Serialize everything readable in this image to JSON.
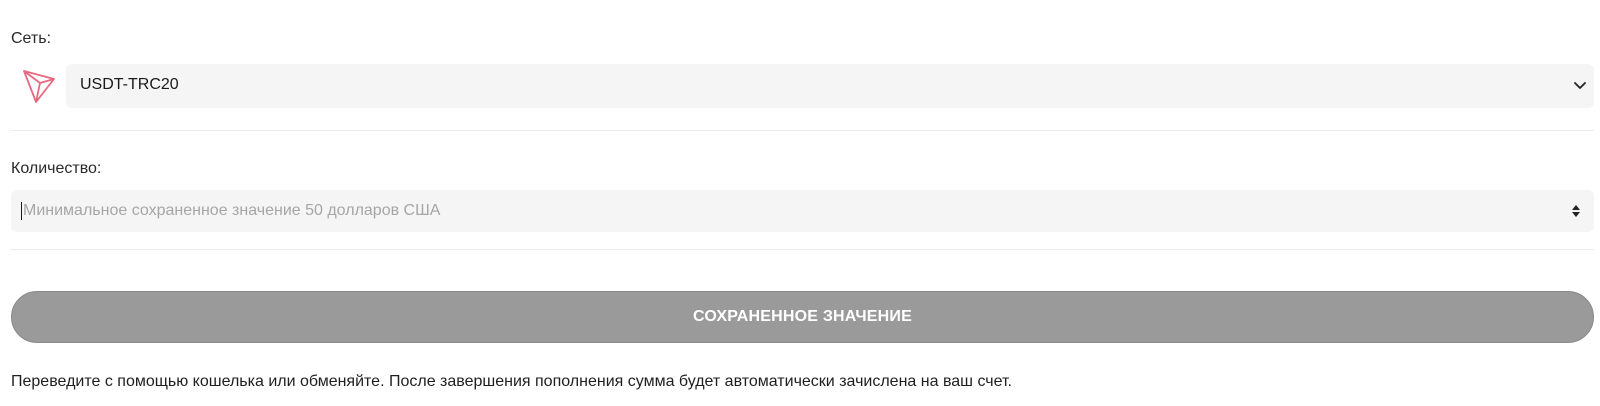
{
  "network": {
    "label": "Сеть:",
    "selected": "USDT-TRC20",
    "icon": "tron-icon",
    "chevron_icon": "chevron-down-icon",
    "brand_color": "#e8687f"
  },
  "amount": {
    "label": "Количество:",
    "placeholder": "Минимальное сохраненное значение 50 долларов США",
    "value": ""
  },
  "save_button": {
    "label": "СОХРАНЕННОЕ ЗНАЧЕНИЕ",
    "color": "#9a9a9a"
  },
  "info": {
    "text": "Переведите с помощью кошелька или обменяйте. После завершения пополнения сумма будет автоматически зачислена на ваш счет."
  }
}
